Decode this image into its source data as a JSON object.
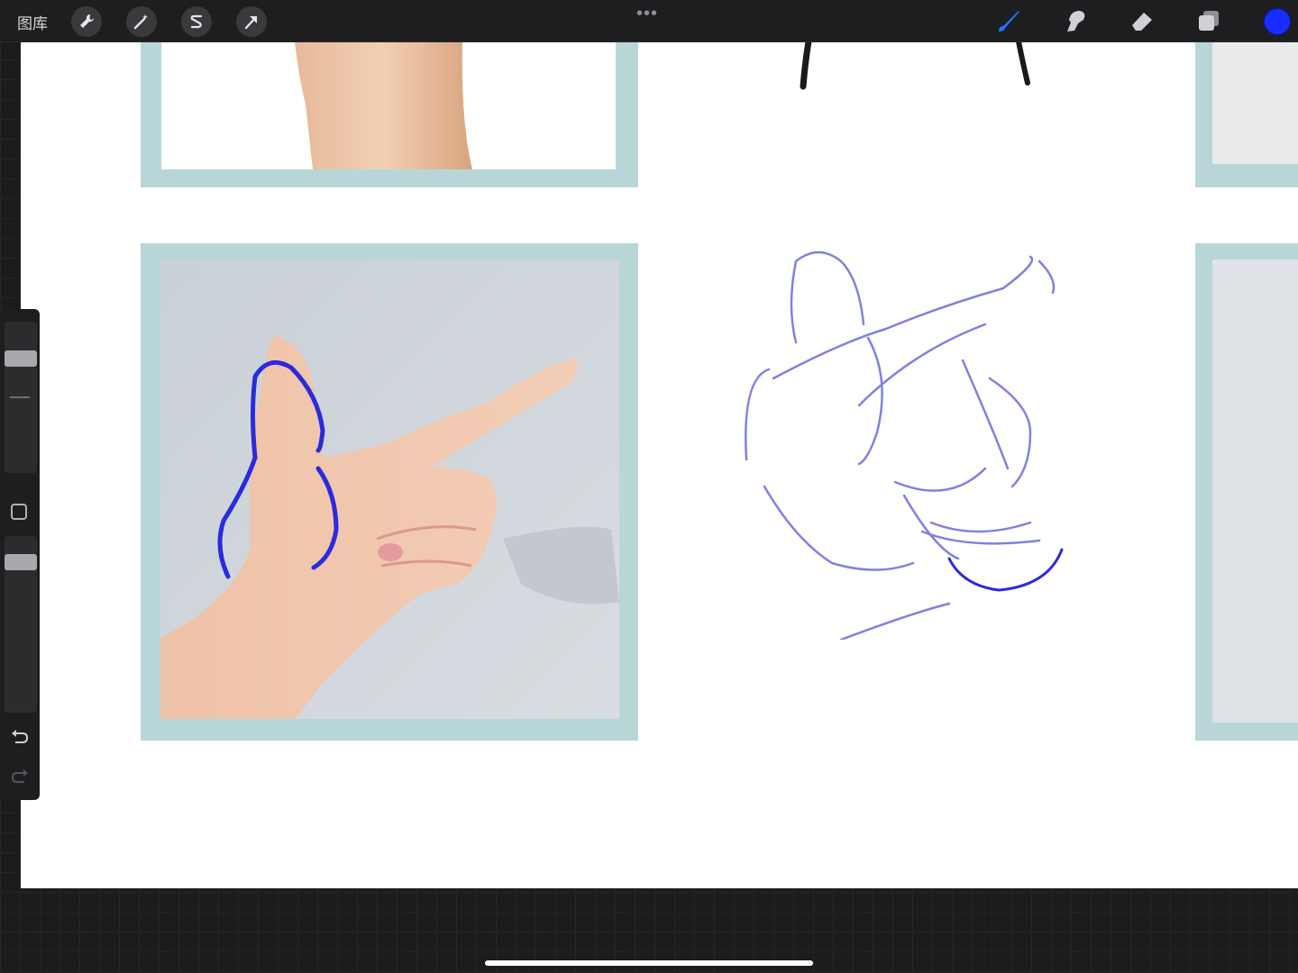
{
  "toolbar": {
    "gallery_label": "图库",
    "left_tools": [
      "wrench-icon",
      "magic-wand-icon",
      "selection-icon",
      "transform-arrow-icon"
    ],
    "more_label": "•••",
    "right_tools": [
      "brush-icon",
      "smudge-icon",
      "eraser-icon",
      "layers-icon"
    ],
    "active_tool": "brush",
    "current_color": "#1a2cff"
  },
  "sidebar": {
    "brush_size_slider": "brush-size",
    "opacity_slider": "opacity",
    "modify_button": "modify-square",
    "undo": "undo-icon",
    "redo": "redo-icon"
  },
  "canvas": {
    "frame_color": "#b8d6d8",
    "stroke_color_blue": "#2a2ae0",
    "sketch_color": "#6b6be0"
  }
}
